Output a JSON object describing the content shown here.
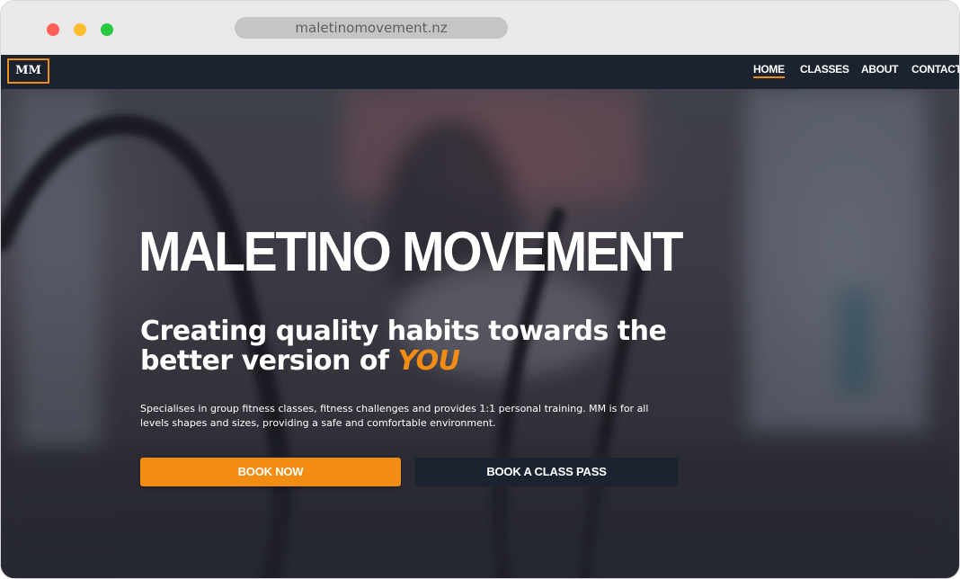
{
  "browser": {
    "url": "maletinomovement.nz"
  },
  "site": {
    "logo": "MM",
    "nav": [
      {
        "label": "HOME",
        "active": true
      },
      {
        "label": "CLASSES",
        "active": false
      },
      {
        "label": "ABOUT",
        "active": false
      },
      {
        "label": "CONTACT",
        "active": false
      }
    ]
  },
  "hero": {
    "title": "MALETINO MOVEMENT",
    "headline": "Creating quality habits towards the better version of",
    "headline_highlight": "YOU",
    "description": "Specialises in group fitness classes, fitness challenges and provides 1:1 personal training. MM is for all levels shapes and sizes, providing a safe and comfortable environment.",
    "primary_button": "BOOK NOW",
    "secondary_button": "BOOK A CLASS PASS"
  },
  "colors": {
    "accent": "#f28c12",
    "navbar": "#1b2230"
  }
}
